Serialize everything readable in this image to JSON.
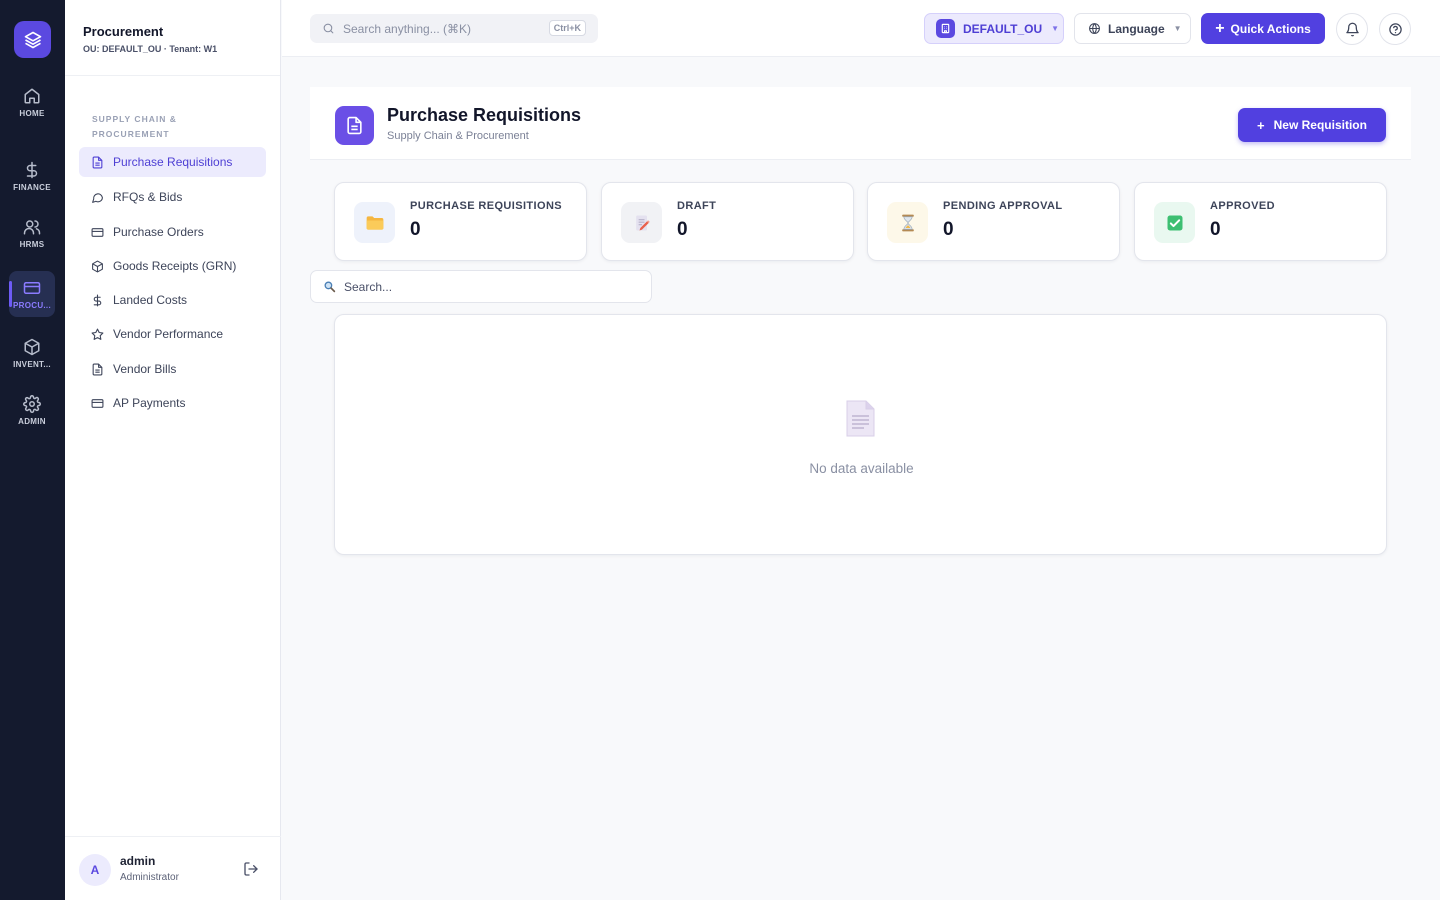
{
  "rail": {
    "items": [
      {
        "label": "HOME",
        "icon": "home-icon"
      },
      {
        "label": "FINANCE",
        "icon": "dollar-icon"
      },
      {
        "label": "HRMS",
        "icon": "users-icon"
      },
      {
        "label": "PROCU...",
        "icon": "card-icon",
        "active": true
      },
      {
        "label": "INVENT...",
        "icon": "box-icon"
      },
      {
        "label": "ADMIN",
        "icon": "gear-icon"
      }
    ]
  },
  "module": {
    "title": "Procurement",
    "subtitle": "OU: DEFAULT_OU · Tenant: W1",
    "section": "SUPPLY CHAIN & PROCUREMENT",
    "items": [
      {
        "label": "Purchase Requisitions",
        "icon": "document-icon",
        "active": true
      },
      {
        "label": "RFQs & Bids",
        "icon": "chat-icon"
      },
      {
        "label": "Purchase Orders",
        "icon": "card-icon"
      },
      {
        "label": "Goods Receipts (GRN)",
        "icon": "box-icon"
      },
      {
        "label": "Landed Costs",
        "icon": "dollar-icon"
      },
      {
        "label": "Vendor Performance",
        "icon": "star-icon"
      },
      {
        "label": "Vendor Bills",
        "icon": "document-icon"
      },
      {
        "label": "AP Payments",
        "icon": "card-icon"
      }
    ]
  },
  "user": {
    "initial": "A",
    "name": "admin",
    "role": "Administrator"
  },
  "topbar": {
    "search_placeholder": "Search anything... (⌘K)",
    "shortcut": "Ctrl+K",
    "ou": "DEFAULT_OU",
    "language": "Language",
    "quick_actions": "Quick Actions"
  },
  "page": {
    "title": "Purchase Requisitions",
    "subtitle": "Supply Chain & Procurement",
    "new_button": "New Requisition"
  },
  "stats": [
    {
      "label": "PURCHASE REQUISITIONS",
      "value": "0",
      "icon": "folder-icon",
      "bg": "#eef2fb"
    },
    {
      "label": "DRAFT",
      "value": "0",
      "icon": "draft-icon",
      "bg": "#f1f2f5"
    },
    {
      "label": "PENDING APPROVAL",
      "value": "0",
      "icon": "hourglass-icon",
      "bg": "#fdf8e9"
    },
    {
      "label": "APPROVED",
      "value": "0",
      "icon": "check-icon",
      "bg": "#e9f8f0"
    }
  ],
  "table": {
    "search_placeholder": "Search...",
    "empty_text": "No data available"
  },
  "colors": {
    "accent": "#5140e0",
    "rail": "#141a2e"
  }
}
